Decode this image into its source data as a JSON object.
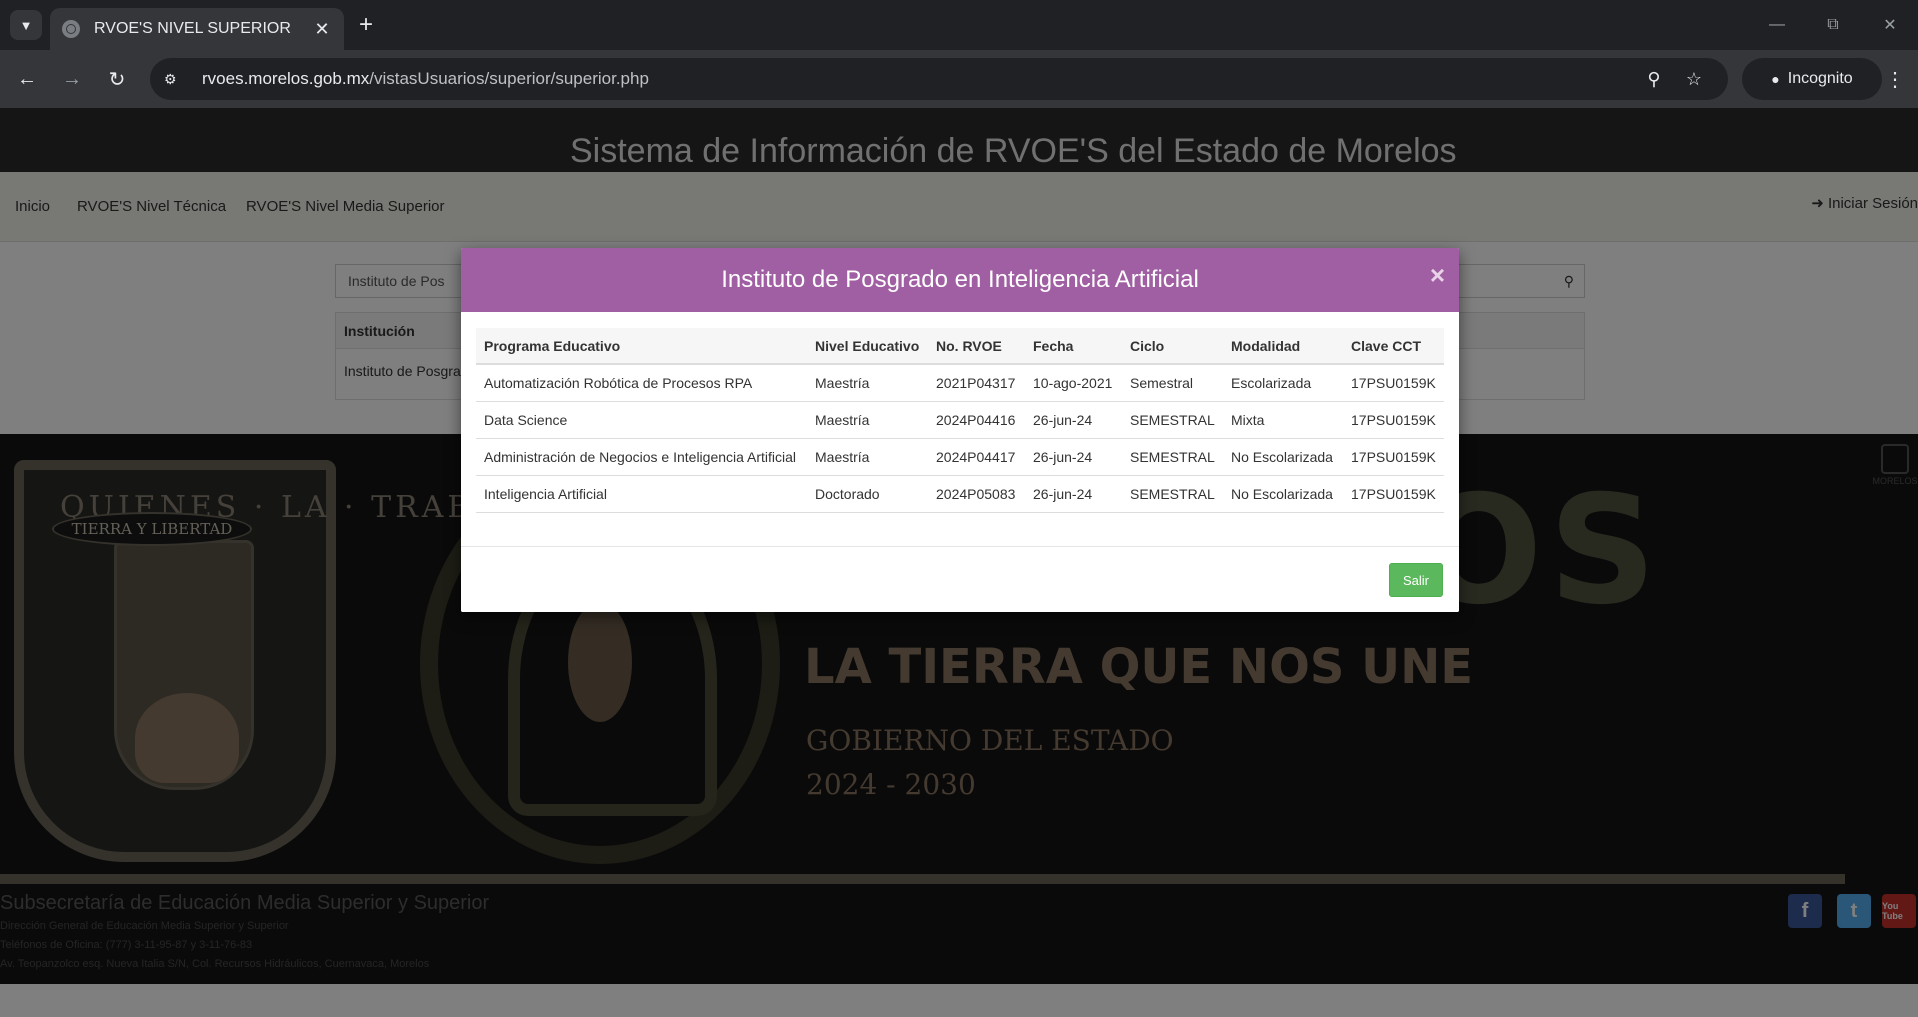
{
  "browser": {
    "tab_title": "RVOE'S NIVEL SUPERIOR",
    "url_host": "rvoes.morelos.gob.mx",
    "url_path": "/vistasUsuarios/superior/superior.php",
    "incognito_label": "Incognito",
    "icons": [
      "tab-search-icon",
      "globe-icon",
      "close-icon",
      "plus-icon",
      "minimize-icon",
      "restore-icon",
      "window-close-icon",
      "back-icon",
      "forward-icon",
      "reload-icon",
      "site-info-icon",
      "zoom-icon",
      "star-icon",
      "incognito-icon",
      "more-icon"
    ]
  },
  "site": {
    "header_title": "Sistema de Información de RVOE'S del Estado de Morelos",
    "nav": {
      "inicio": "Inicio",
      "tecnica": "RVOE'S Nivel Técnica",
      "media_superior": "RVOE'S Nivel Media Superior",
      "login": "Iniciar Sesión"
    },
    "search_value": "Instituto de Pos",
    "results": {
      "header": "Institución",
      "row": "Instituto de Posgra"
    }
  },
  "banner": {
    "seal_motto": "QUIENES · LA · TRABAJAN",
    "seal_ribbon": "TIERRA Y LIBERTAD",
    "title": "MORELOS",
    "slogan": "LA TIERRA QUE NOS UNE",
    "gobierno": "GOBIERNO DEL ESTADO",
    "years": "2024 - 2030",
    "corner_label": "MORELOS"
  },
  "footer": {
    "title": "Subsecretaría de Educación Media Superior y Superior",
    "line1": "Dirección General de Educación Media Superior y Superior",
    "line2": "Teléfonos de Oficina: (777) 3-11-95-87 y 3-11-76-83",
    "line3": "Av. Teopanzolco esq. Nueva Italia S/N, Col. Recursos Hidráulicos, Cuernavaca, Morelos",
    "social": {
      "facebook": "f",
      "twitter": "t",
      "youtube": "You Tube"
    }
  },
  "modal": {
    "title": "Instituto de Posgrado en Inteligencia Artificial",
    "close_label": "×",
    "button_label": "Salir",
    "headers": [
      "Programa Educativo",
      "Nivel Educativo",
      "No. RVOE",
      "Fecha",
      "Ciclo",
      "Modalidad",
      "Clave CCT"
    ],
    "rows": [
      [
        "Automatización Robótica de Procesos RPA",
        "Maestría",
        "2021P04317",
        "10-ago-2021",
        "Semestral",
        "Escolarizada",
        "17PSU0159K"
      ],
      [
        "Data Science",
        "Maestría",
        "2024P04416",
        "26-jun-24",
        "SEMESTRAL",
        "Mixta",
        "17PSU0159K"
      ],
      [
        "Administración de Negocios e Inteligencia Artificial",
        "Maestría",
        "2024P04417",
        "26-jun-24",
        "SEMESTRAL",
        "No Escolarizada",
        "17PSU0159K"
      ],
      [
        "Inteligencia Artificial",
        "Doctorado",
        "2024P05083",
        "26-jun-24",
        "SEMESTRAL",
        "No Escolarizada",
        "17PSU0159K"
      ]
    ]
  },
  "colors": {
    "modal_header": "#a05fa2",
    "salir_button": "#5cb85c",
    "browser_dark": "#202124"
  }
}
